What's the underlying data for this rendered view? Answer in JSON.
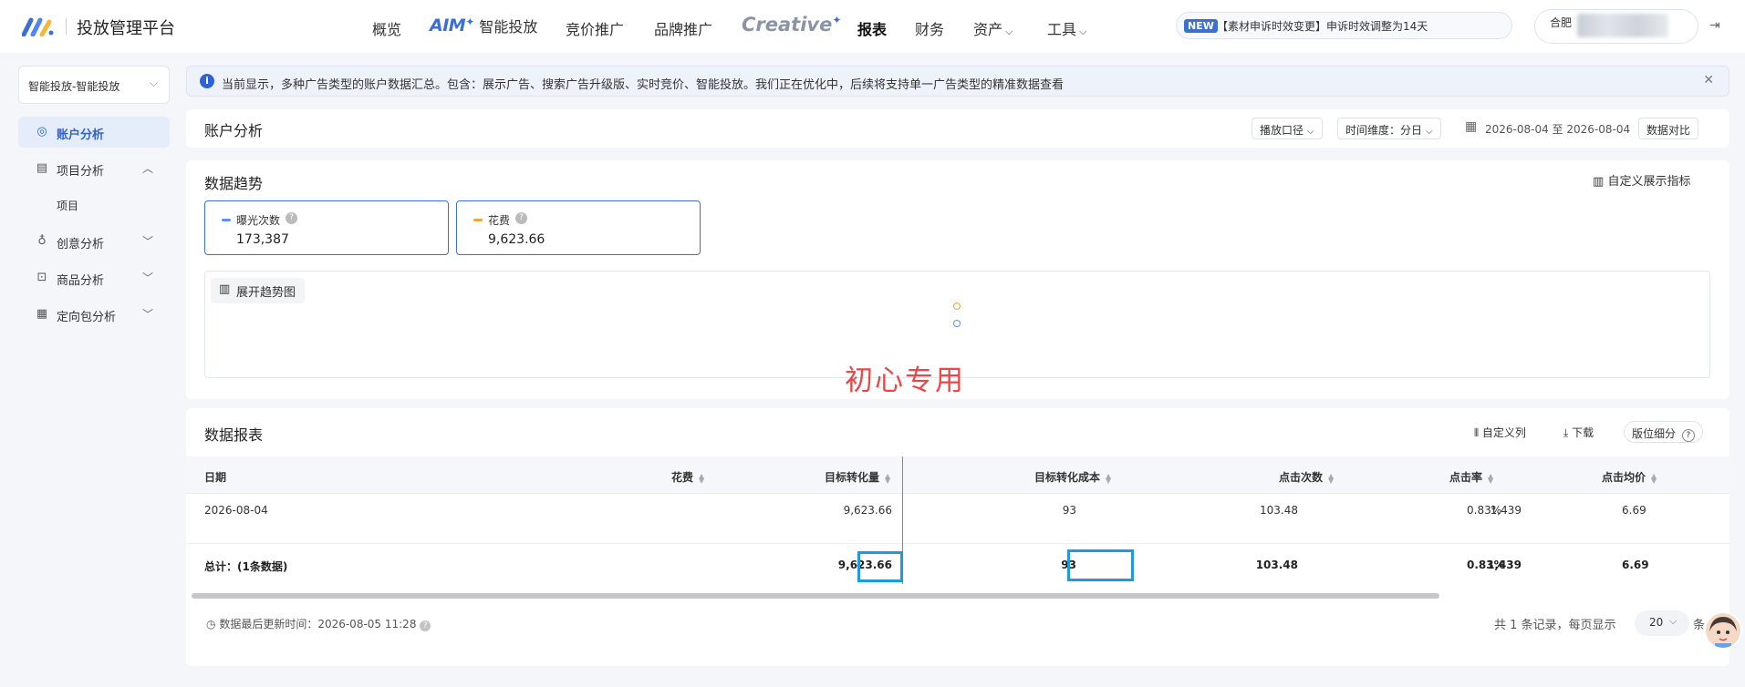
{
  "app": {
    "title": "投放管理平台"
  },
  "nav": {
    "items": [
      "概览",
      "智能投放",
      "竞价推广",
      "品牌推广",
      "报表",
      "财务",
      "资产",
      "工具"
    ],
    "aim_brand": "AIM",
    "creative_brand": "Creative"
  },
  "notice": {
    "badge": "NEW",
    "text": "【素材申诉时效变更】申诉时效调整为14天"
  },
  "user": {
    "name_prefix": "合肥"
  },
  "sidebar": {
    "selector": "智能投放-智能投放",
    "items": [
      {
        "label": "账户分析"
      },
      {
        "label": "项目分析"
      },
      {
        "label": "项目"
      },
      {
        "label": "创意分析"
      },
      {
        "label": "商品分析"
      },
      {
        "label": "定向包分析"
      }
    ]
  },
  "info": {
    "text": "当前显示，多种广告类型的账户数据汇总。包含：展示广告、搜索广告升级版、实时竞价、智能投放。我们正在优化中，后续将支持单一广告类型的精准数据查看"
  },
  "account": {
    "title": "账户分析",
    "caliber": "播放口径",
    "time_dim": "时间维度：分日",
    "date_range": "2026-08-04 至 2026-08-04",
    "compare": "数据对比"
  },
  "trend": {
    "title": "数据趋势",
    "custom_metrics": "自定义展示指标",
    "metrics": [
      {
        "name": "曝光次数",
        "value": "173,387",
        "color": "#5b8ff9"
      },
      {
        "name": "花费",
        "value": "9,623.66",
        "color": "#f6a23b"
      }
    ],
    "expand_label": "展开趋势图",
    "watermark": "初心专用"
  },
  "report": {
    "title": "数据报表",
    "custom_cols": "自定义列",
    "download": "下载",
    "position": "版位细分",
    "columns": [
      "日期",
      "花费",
      "目标转化量",
      "目标转化成本",
      "点击次数",
      "点击率",
      "点击均价"
    ],
    "rows": [
      [
        "2026-08-04",
        "9,623.66",
        "93",
        "103.48",
        "1,439",
        "0.83%",
        "6.69"
      ]
    ],
    "total": [
      "总计：(1条数据)",
      "9,623.66",
      "93",
      "103.48",
      "1,439",
      "0.83%",
      "6.69"
    ],
    "updated": "数据最后更新时间：2026-08-05 11:28",
    "pager_text": "共 1 条记录，每页显示",
    "page_size": "20",
    "pager_suffix": "条"
  }
}
